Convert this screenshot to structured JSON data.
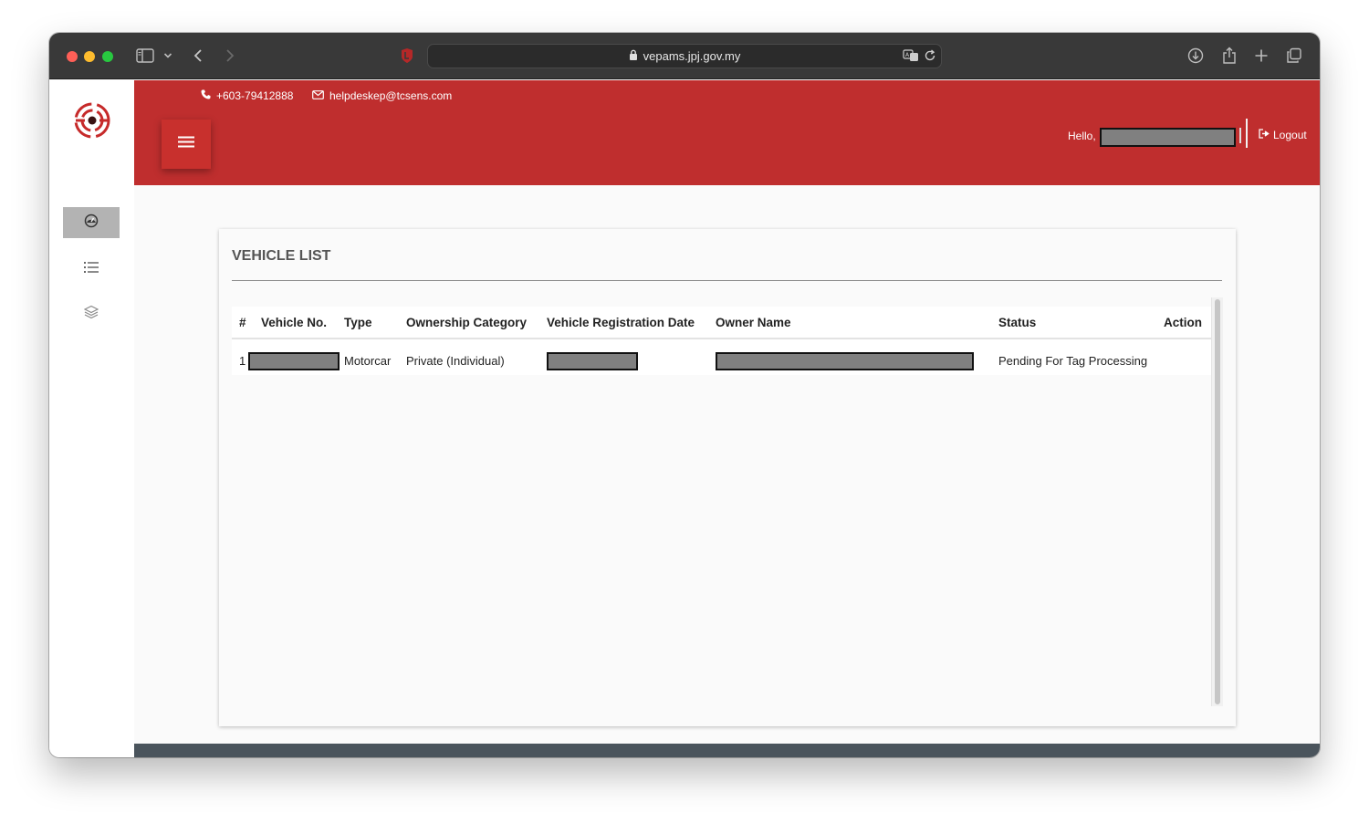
{
  "browser": {
    "url": "vepams.jpj.gov.my"
  },
  "header": {
    "phone": "+603-79412888",
    "email": "helpdeskep@tcsens.com",
    "greeting": "Hello,",
    "logout_label": "Logout"
  },
  "sidebar": {
    "items": [
      {
        "icon": "dashboard-icon",
        "active": true
      },
      {
        "icon": "list-icon",
        "active": false
      },
      {
        "icon": "layers-icon",
        "active": false
      }
    ]
  },
  "main": {
    "title": "VEHICLE LIST",
    "table": {
      "columns": [
        "#",
        "Vehicle No.",
        "Type",
        "Ownership Category",
        "Vehicle Registration Date",
        "Owner Name",
        "Status",
        "Action"
      ],
      "rows": [
        {
          "index": "1",
          "vehicle_no": "[redacted]",
          "type": "Motorcar",
          "ownership_category": "Private (Individual)",
          "registration_date": "[redacted]",
          "owner_name": "[redacted]",
          "status": "Pending For Tag Processing",
          "action": ""
        }
      ]
    }
  },
  "colors": {
    "header_red": "#bf2e2e",
    "toolbar": "#393939",
    "redaction": "#808080"
  }
}
